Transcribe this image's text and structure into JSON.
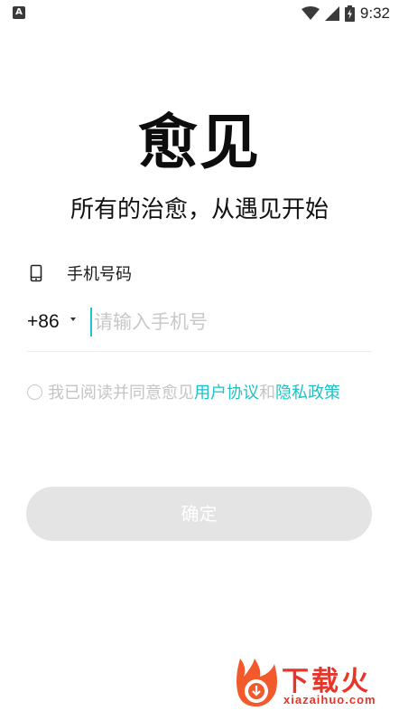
{
  "status_bar": {
    "notification_badge": "A",
    "time": "9:32",
    "icons": [
      "wifi-icon",
      "cell-signal-icon",
      "battery-charging-icon"
    ]
  },
  "app": {
    "title": "愈见",
    "slogan": "所有的治愈，从遇见开始"
  },
  "phone": {
    "label": "手机号码",
    "label_icon": "phone-icon",
    "country_code": "+86",
    "placeholder": "请输入手机号",
    "value": ""
  },
  "agreement": {
    "checked": false,
    "prefix": "我已阅读并同意愈见",
    "user_agreement": "用户协议",
    "conjunction": "和",
    "privacy_policy": "隐私政策"
  },
  "confirm_button": {
    "label": "确定",
    "enabled": false
  },
  "watermark": {
    "chinese": "下载火",
    "latin": "xiazaihuo.com"
  },
  "colors": {
    "accent": "#1fc1c6",
    "button_disabled": "#e4e4e4",
    "placeholder": "#c8c8c8",
    "watermark": "#e8352a"
  }
}
